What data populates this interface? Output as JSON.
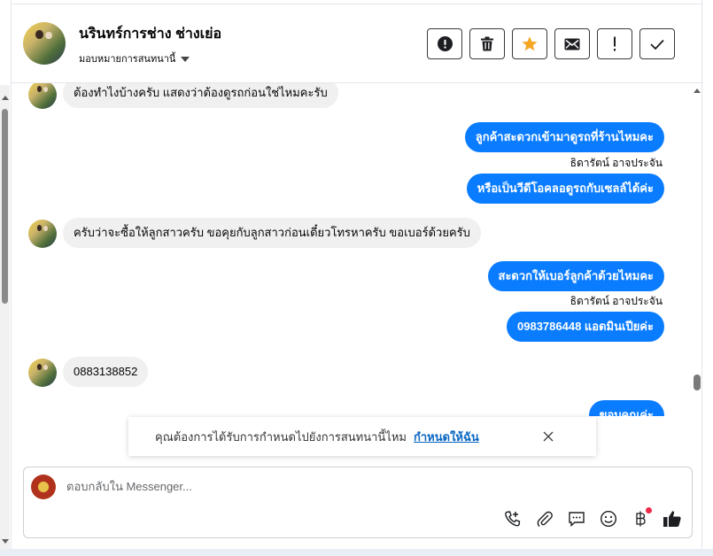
{
  "header": {
    "name": "นรินทร์การช่าง ช่างเย่อ",
    "subtitle": "มอบหมายการสนทนานี้",
    "buttons": [
      {
        "id": "spam",
        "icon": "alert-circle-icon"
      },
      {
        "id": "delete",
        "icon": "trash-icon"
      },
      {
        "id": "star",
        "icon": "star-icon",
        "color": "#f5a623"
      },
      {
        "id": "mail",
        "icon": "envelope-icon"
      },
      {
        "id": "important",
        "icon": "exclamation-icon"
      },
      {
        "id": "done",
        "icon": "check-icon"
      }
    ]
  },
  "messages": [
    {
      "type": "in",
      "text": "ต้องทำไงบ้างครับ แสดงว่าต้องดูรถก่อนใช่ไหมคะรับ"
    },
    {
      "type": "out",
      "text": "ลูกค้าสะดวกเข้ามาดูรถที่ร้านไหมคะ"
    },
    {
      "type": "sender",
      "text": "ธิดารัตน์ อาจประจัน"
    },
    {
      "type": "out",
      "text": "หรือเป็นวีดีโอคลอดูรถกับเซลล์ได้ค่ะ"
    },
    {
      "type": "in",
      "text": "ครับว่าจะซื้อให้ลูกสาวครับ ขอคุยกับลูกสาวก่อนเดี๋ยวโทรหาครับ ขอเบอร์ด้วยครับ"
    },
    {
      "type": "out",
      "text": "สะดวกให้เบอร์ลูกค้าด้วยไหมคะ"
    },
    {
      "type": "sender",
      "text": "ธิดารัตน์ อาจประจัน"
    },
    {
      "type": "out",
      "text": "0983786448 แอดมินเปียค่ะ"
    },
    {
      "type": "in",
      "text": "0883138852"
    },
    {
      "type": "out",
      "text": "ขอบคุณค่ะ"
    }
  ],
  "notice": {
    "text": "คุณต้องการได้รับการกำหนดไปยังการสนทนานี้ไหม",
    "link": "กำหนดให้ฉัน"
  },
  "composer": {
    "placeholder": "ตอบกลับใน Messenger...",
    "value": "",
    "tools": [
      "phone-plus-icon",
      "paperclip-icon",
      "chat-bubble-icon",
      "smile-icon",
      "baht-icon",
      "thumbs-up-icon"
    ]
  }
}
